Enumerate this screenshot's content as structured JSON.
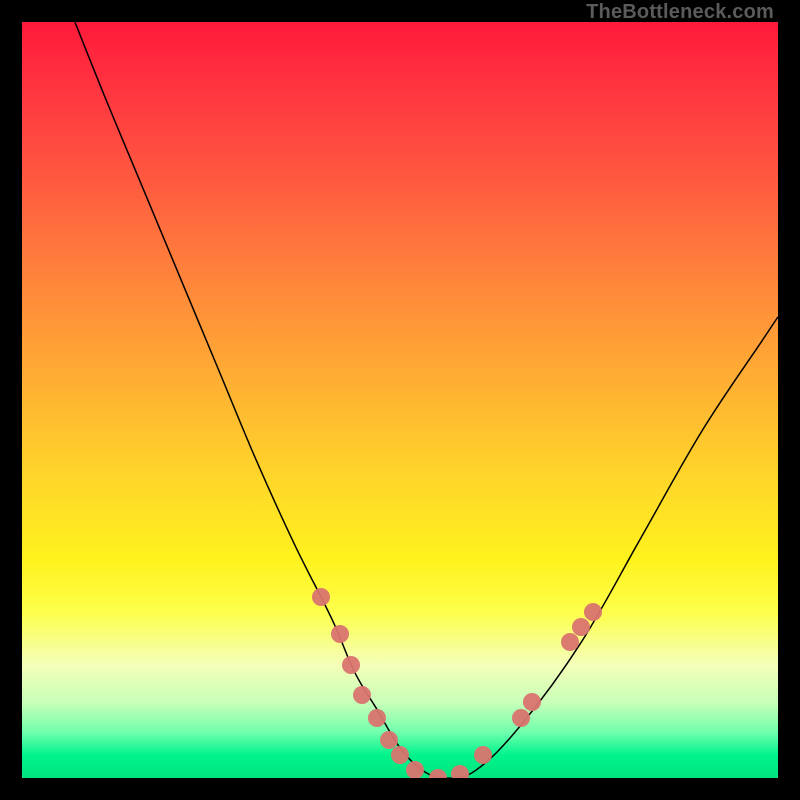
{
  "attribution": "TheBottleneck.com",
  "chart_data": {
    "type": "line",
    "title": "",
    "xlabel": "",
    "ylabel": "",
    "xlim": [
      0,
      100
    ],
    "ylim": [
      0,
      100
    ],
    "grid": false,
    "legend": false,
    "series": [
      {
        "name": "curve",
        "x": [
          7,
          11,
          16,
          21,
          26,
          31,
          36,
          41,
          44,
          47,
          50,
          53,
          56,
          60,
          66,
          74,
          82,
          90,
          98,
          100
        ],
        "y": [
          100,
          90,
          78,
          66,
          54,
          42,
          31,
          21,
          14,
          9,
          4,
          1,
          0,
          1,
          7,
          18,
          32,
          46,
          58,
          61
        ],
        "stroke": "#000000",
        "stroke_width": 1.5
      },
      {
        "name": "markers",
        "type": "scatter",
        "color": "#d9746f",
        "points": [
          {
            "x": 39.5,
            "y": 24
          },
          {
            "x": 42.0,
            "y": 19
          },
          {
            "x": 43.5,
            "y": 15
          },
          {
            "x": 45.0,
            "y": 11
          },
          {
            "x": 47.0,
            "y": 8
          },
          {
            "x": 48.5,
            "y": 5
          },
          {
            "x": 50.0,
            "y": 3
          },
          {
            "x": 52.0,
            "y": 1
          },
          {
            "x": 55.0,
            "y": 0
          },
          {
            "x": 58.0,
            "y": 0.5
          },
          {
            "x": 61.0,
            "y": 3
          },
          {
            "x": 66.0,
            "y": 8
          },
          {
            "x": 67.5,
            "y": 10
          },
          {
            "x": 72.5,
            "y": 18
          },
          {
            "x": 74.0,
            "y": 20
          },
          {
            "x": 75.5,
            "y": 22
          }
        ]
      }
    ]
  }
}
